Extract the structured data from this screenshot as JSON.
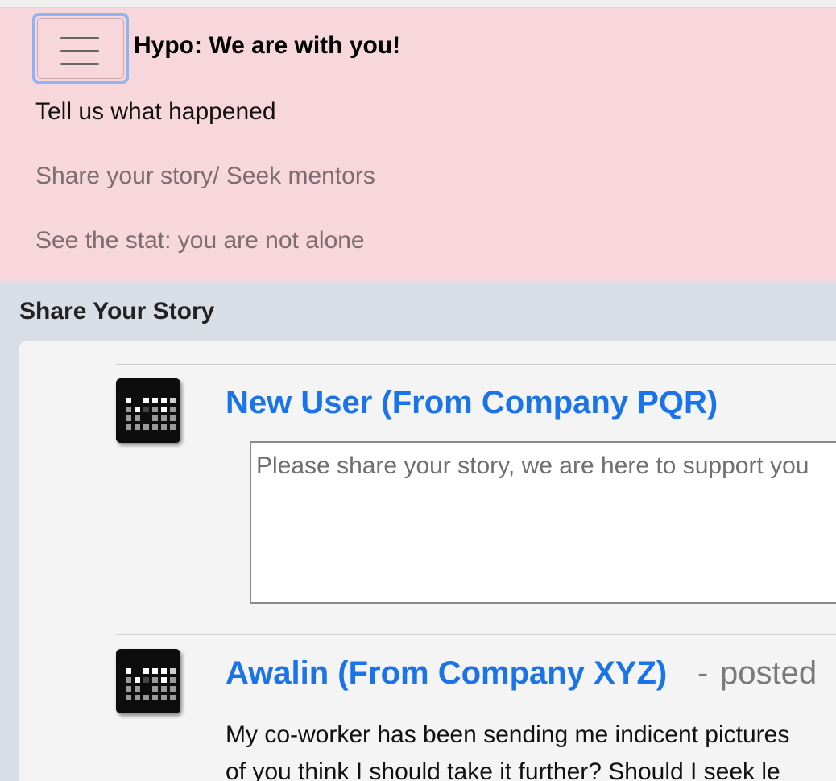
{
  "navbar": {
    "brand": "Hypo: We are with you!",
    "toggle_icon": "hamburger-icon",
    "background": "#f8d7dc",
    "links": [
      {
        "label": "Tell us what happened",
        "active": true
      },
      {
        "label": "Share your story/ Seek mentors",
        "active": false
      },
      {
        "label": "See the stat: you are not alone",
        "active": false
      }
    ]
  },
  "main": {
    "section_title": "Share Your Story",
    "new_post": {
      "author": "New User (From Company PQR)",
      "avatar_icon": "equalizer-app-icon",
      "placeholder": "Please share your story, we are here to support you"
    },
    "posts": [
      {
        "author": "Awalin (From Company XYZ)",
        "separator": "-",
        "meta": "posted",
        "avatar_icon": "equalizer-app-icon",
        "body_lines": [
          "My co-worker has been sending me indicent pictures",
          "of you think I should take it further? Should I seek le"
        ]
      }
    ]
  },
  "colors": {
    "link_blue": "#1a73e8",
    "page_bg": "#d9dee6",
    "card_bg": "#f4f4f4"
  }
}
